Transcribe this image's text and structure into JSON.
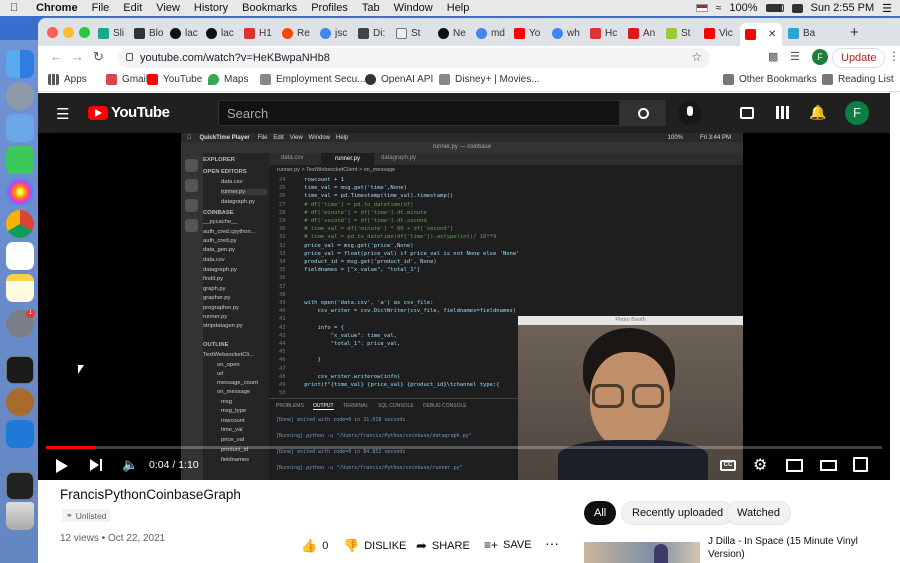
{
  "menubar": {
    "app": "Chrome",
    "items": [
      "File",
      "Edit",
      "View",
      "History",
      "Bookmarks",
      "Profiles",
      "Tab",
      "Window",
      "Help"
    ],
    "battery": "100%",
    "clock": "Sun 2:55 PM"
  },
  "dock": {
    "settings_badge": "1"
  },
  "tabs": [
    "Sli",
    "Blo",
    "lac",
    "lac",
    "H1",
    "Re",
    "jsc",
    "Di:",
    "St",
    "Ne",
    "md",
    "Yo",
    "wh",
    "Hc",
    "An",
    "St",
    "Vic",
    "Ba"
  ],
  "browser": {
    "url": "youtube.com/watch?v=HeKBwpaNHb8",
    "profile_initial": "F",
    "update_label": "Update"
  },
  "bookmarks": [
    "Apps",
    "Gmail",
    "YouTube",
    "Maps",
    "Employment Secu...",
    "OpenAI API",
    "Disney+ | Movies...",
    "Other Bookmarks",
    "Reading List"
  ],
  "youtube": {
    "logo_text": "YouTube",
    "search_placeholder": "Search",
    "avatar_initial": "F"
  },
  "video": {
    "mac_app": "QuickTime Player",
    "mac_menus": [
      "File",
      "Edit",
      "View",
      "Window",
      "Help"
    ],
    "mac_battery": "100%",
    "mac_clock": "Fri 3:44 PM",
    "window_title": "runner.py — coinbase",
    "sidebar": [
      "EXPLORER",
      "OPEN EDITORS",
      "data.csv",
      "runner.py",
      "datagraph.py",
      "COINBASE",
      "__pycache__",
      "auth_cred.cpython...",
      "auth_cred.py",
      "data_gen.py",
      "data.csv",
      "datagraph.py",
      "findit.py",
      "graph.py",
      "grapher.py",
      "prographer.py",
      "runner.py",
      "stripdatagen.py",
      "OUTLINE",
      "TextWebsocketCli...",
      "on_open",
      "url",
      "message_count",
      "on_message",
      "msg",
      "msg_type",
      "rowcount",
      "time_val",
      "price_val",
      "product_id",
      "fieldnames"
    ],
    "editor_tabs": [
      "data.csv",
      "runner.py",
      "datagraph.py"
    ],
    "breadcrumb": "runner.py > TextWebsocketClient > on_message",
    "code_start_line": 24,
    "code": [
      "    rowcount + 1",
      "    time_val = msg.get('time',None)",
      "    time_val = pd.Timestamp(time_val).timestamp()",
      "    # df['time'] = pd.to_datetime(df)",
      "    # df['minute'] = df['time'].dt.minute",
      "    # df['second'] = df['time'].dt.second",
      "    # time_val = df['minute'] * 60 + df['second']",
      "    # time_val = pd.to_datetime(df['time']).astype(int)/ 10**9",
      "    price_val = msg.get('price',None)",
      "    price_val = float(price_val) if price_val is not None else 'None'",
      "    product_id = msg.get('product_id', None)",
      "    fieldnames = [\"x_value\", \"total_1\"]",
      "",
      "",
      "",
      "    with open('data.csv', 'a') as csv_file:",
      "        csv_writer = csv.DictWriter(csv_file, fieldnames=fieldnames)",
      "",
      "        info = {",
      "            \"x_value\": time_val,",
      "            \"total_1\": price_val,",
      "",
      "        }",
      "",
      "        csv_writer.writerow(info)",
      "    print(f\"{time_val} {price_val} {product_id}\\tchannel type:{",
      ""
    ],
    "panel_tabs": [
      "PROBLEMS",
      "OUTPUT",
      "TERMINAL",
      "SQL CONSOLE",
      "DEBUG CONSOLE"
    ],
    "output": [
      "[Done] exited with code=0 in 31.018 seconds",
      "[Running] python -u \"/Users/francis/Python/coinbase/datagraph.py\"",
      "[Done] exited with code=0 in 84.852 seconds",
      "[Running] python -u \"/Users/francis/Python/coinbase/runner.py\""
    ],
    "photobooth_title": "Photo Booth"
  },
  "player": {
    "time": "0:04 / 1:10",
    "progress": 0.06
  },
  "video_info": {
    "title": "FrancisPythonCoinbaseGraph",
    "visibility": "Unlisted",
    "views": "12 views",
    "date": "Oct 22, 2021",
    "likes": "0",
    "dislike_label": "DISLIKE",
    "share_label": "SHARE",
    "save_label": "SAVE"
  },
  "chips": [
    "All",
    "Recently uploaded",
    "Watched"
  ],
  "recommended": {
    "title": "J Dilla - In Space (15 Minute Vinyl Version)"
  },
  "colors": {
    "youtube_red": "#ff0000",
    "player_bg": "#000000",
    "header_bg": "#202020"
  }
}
